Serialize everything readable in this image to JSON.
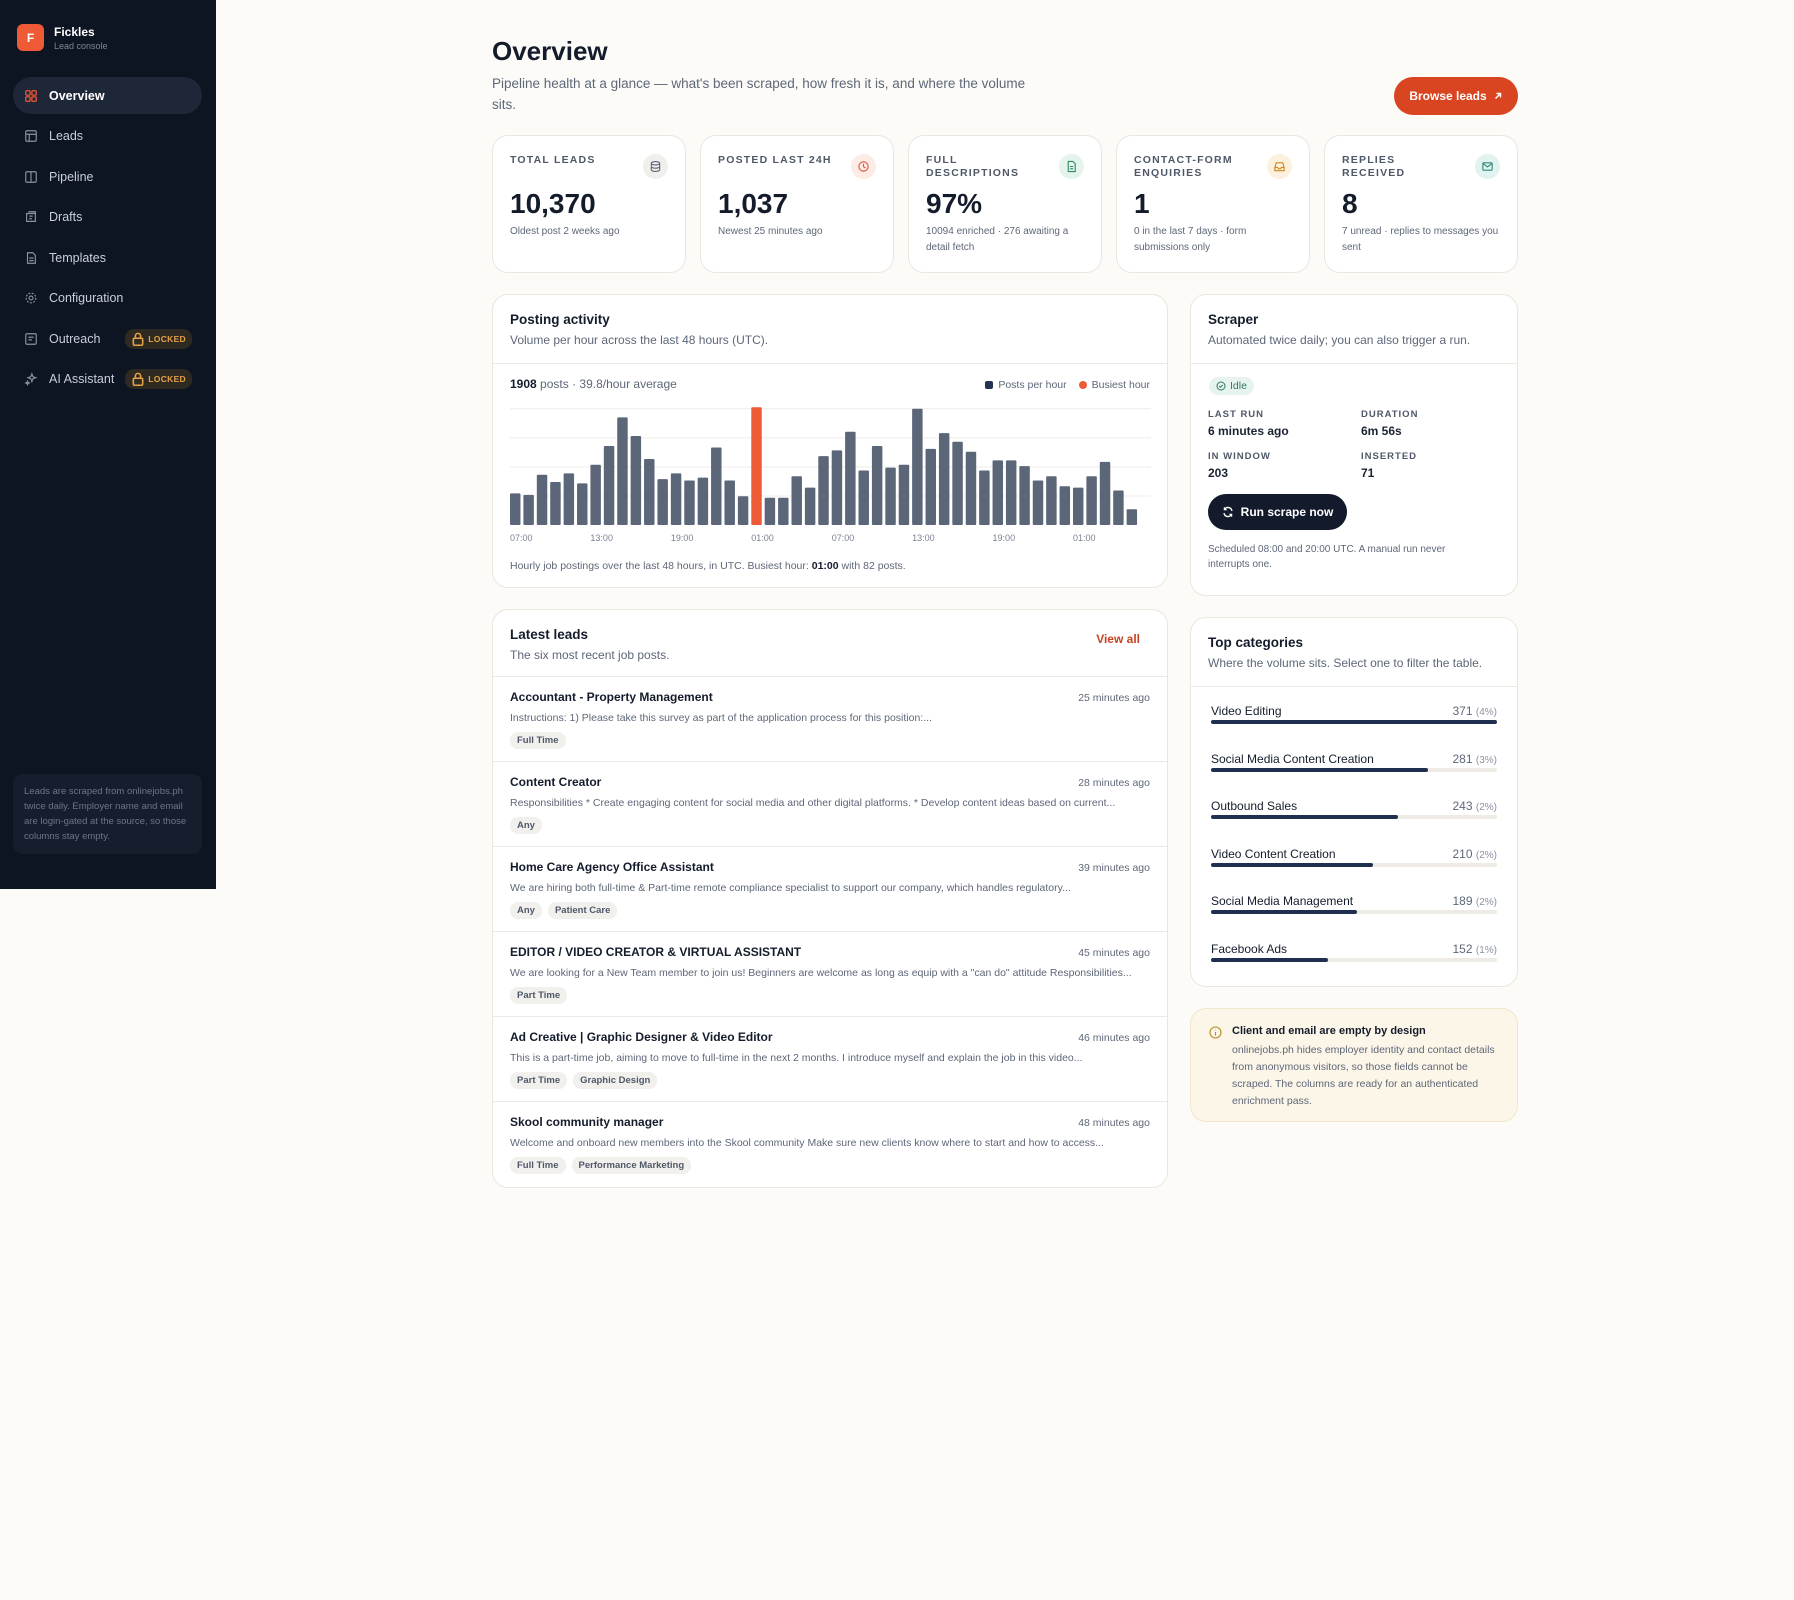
{
  "brand": {
    "logo_letter": "F",
    "name": "Fickles",
    "subtitle": "Lead console"
  },
  "nav": [
    {
      "label": "Overview",
      "icon": "grid-icon",
      "active": true
    },
    {
      "label": "Leads",
      "icon": "table-icon"
    },
    {
      "label": "Pipeline",
      "icon": "columns-icon"
    },
    {
      "label": "Drafts",
      "icon": "drafts-icon"
    },
    {
      "label": "Templates",
      "icon": "document-icon"
    },
    {
      "label": "Configuration",
      "icon": "gear-icon"
    },
    {
      "label": "Outreach",
      "icon": "outreach-icon",
      "badge": "LOCKED"
    },
    {
      "label": "AI Assistant",
      "icon": "sparkle-icon",
      "badge": "LOCKED"
    }
  ],
  "sidebar_note": "Leads are scraped from onlinejobs.ph twice daily. Employer name and email are login-gated at the source, so those columns stay empty.",
  "page": {
    "title": "Overview",
    "subtitle": "Pipeline health at a glance — what's been scraped, how fresh it is, and where the volume sits.",
    "browse_button": "Browse leads"
  },
  "stats": [
    {
      "label": "TOTAL LEADS",
      "value": "10,370",
      "note": "Oldest post 2 weeks ago",
      "icon": "database-icon",
      "color": "#5e6778",
      "bg": "#f1efeb"
    },
    {
      "label": "POSTED LAST 24H",
      "value": "1,037",
      "note": "Newest 25 minutes ago",
      "icon": "clock-icon",
      "color": "#e0573a",
      "bg": "#fdebe6"
    },
    {
      "label": "FULL DESCRIPTIONS",
      "value": "97%",
      "note": "10094 enriched · 276 awaiting a detail fetch",
      "icon": "file-text-icon",
      "color": "#2f8a64",
      "bg": "#e4f3ec"
    },
    {
      "label": "CONTACT-FORM ENQUIRIES",
      "value": "1",
      "note": "0 in the last 7 days · form submissions only",
      "icon": "inbox-icon",
      "color": "#c98a1e",
      "bg": "#fcf1dd"
    },
    {
      "label": "REPLIES RECEIVED",
      "value": "8",
      "note": "7 unread · replies to messages you sent",
      "icon": "mail-icon",
      "color": "#2f8a7a",
      "bg": "#e2f2ef"
    }
  ],
  "activity": {
    "title": "Posting activity",
    "subtitle": "Volume per hour across the last 48 hours (UTC).",
    "summary_count": "1908",
    "summary_rest": "posts · 39.8/hour average",
    "legend_posts": "Posts per hour",
    "legend_busiest": "Busiest hour",
    "footer_pre": "Hourly job postings over the last 48 hours, in UTC. Busiest hour:",
    "footer_hour": "01:00",
    "footer_post": "with 82 posts."
  },
  "chart_data": {
    "type": "bar",
    "ylim": [
      0,
      85
    ],
    "x_ticks": [
      "07:00",
      "13:00",
      "19:00",
      "01:00",
      "07:00",
      "13:00",
      "19:00",
      "01:00"
    ],
    "values": [
      22,
      21,
      35,
      30,
      36,
      29,
      42,
      55,
      75,
      62,
      46,
      32,
      36,
      31,
      33,
      54,
      31,
      20,
      82,
      19,
      19,
      34,
      26,
      48,
      52,
      65,
      38,
      55,
      40,
      42,
      81,
      53,
      64,
      58,
      51,
      38,
      45,
      45,
      41,
      31,
      34,
      27,
      26,
      34,
      44,
      24,
      11
    ],
    "busiest_index": 18,
    "bar_color": "#5b6679",
    "highlight_color": "#ee5a36"
  },
  "scraper": {
    "title": "Scraper",
    "subtitle": "Automated twice daily; you can also trigger a run.",
    "status": "Idle",
    "last_run_label": "LAST RUN",
    "last_run": "6 minutes ago",
    "duration_label": "DURATION",
    "duration": "6m 56s",
    "in_window_label": "IN WINDOW",
    "in_window": "203",
    "inserted_label": "INSERTED",
    "inserted": "71",
    "run_button": "Run scrape now",
    "note": "Scheduled 08:00 and 20:00 UTC. A manual run never interrupts one."
  },
  "latest": {
    "title": "Latest leads",
    "subtitle": "The six most recent job posts.",
    "view_all": "View all",
    "items": [
      {
        "title": "Accountant - Property Management",
        "time": "25 minutes ago",
        "desc": "Instructions: 1) Please take this survey as part of the application process for this position:...",
        "tags": [
          "Full Time"
        ]
      },
      {
        "title": "Content Creator",
        "time": "28 minutes ago",
        "desc": "Responsibilities * Create engaging content for social media and other digital platforms. * Develop content ideas based on current...",
        "tags": [
          "Any"
        ]
      },
      {
        "title": "Home Care Agency Office Assistant",
        "time": "39 minutes ago",
        "desc": "We are hiring both full-time & Part-time remote compliance specialist to support our company, which handles regulatory...",
        "tags": [
          "Any",
          "Patient Care"
        ]
      },
      {
        "title": "EDITOR / VIDEO CREATOR & VIRTUAL ASSISTANT",
        "time": "45 minutes ago",
        "desc": "We are looking for a New Team member to join us! Beginners are welcome as long as equip with a \"can do\" attitude Responsibilities...",
        "tags": [
          "Part Time"
        ]
      },
      {
        "title": "Ad Creative | Graphic Designer & Video Editor",
        "time": "46 minutes ago",
        "desc": "This is a part-time job, aiming to move to full-time in the next 2 months. I introduce myself and explain the job in this video...",
        "tags": [
          "Part Time",
          "Graphic Design"
        ]
      },
      {
        "title": "Skool community manager",
        "time": "48 minutes ago",
        "desc": "Welcome and onboard new members into the Skool community Make sure new clients know where to start and how to access...",
        "tags": [
          "Full Time",
          "Performance Marketing"
        ]
      }
    ]
  },
  "categories": {
    "title": "Top categories",
    "subtitle": "Where the volume sits. Select one to filter the table.",
    "items": [
      {
        "name": "Video Editing",
        "count": "371",
        "pct": "(4%)",
        "share": 1.0
      },
      {
        "name": "Social Media Content Creation",
        "count": "281",
        "pct": "(3%)",
        "share": 0.757
      },
      {
        "name": "Outbound Sales",
        "count": "243",
        "pct": "(2%)",
        "share": 0.655
      },
      {
        "name": "Video Content Creation",
        "count": "210",
        "pct": "(2%)",
        "share": 0.566
      },
      {
        "name": "Social Media Management",
        "count": "189",
        "pct": "(2%)",
        "share": 0.509
      },
      {
        "name": "Facebook Ads",
        "count": "152",
        "pct": "(1%)",
        "share": 0.41
      }
    ]
  },
  "info": {
    "title": "Client and email are empty by design",
    "text": "onlinejobs.ph hides employer identity and contact details from anonymous visitors, so those fields cannot be scraped. The columns are ready for an authenticated enrichment pass."
  }
}
